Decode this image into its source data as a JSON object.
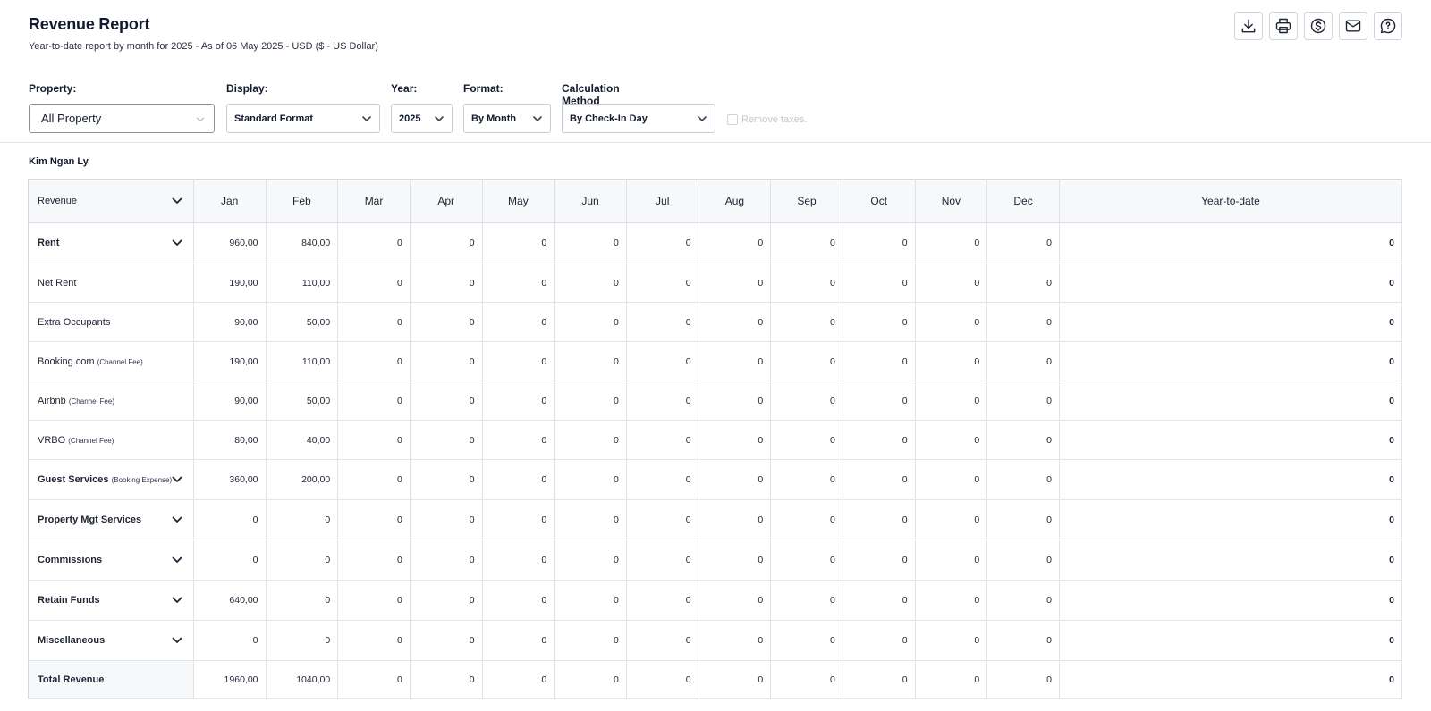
{
  "header": {
    "title": "Revenue Report",
    "subtitle": "Year-to-date report by month for 2025 - As of 06 May 2025 - USD ($ - US Dollar)"
  },
  "toolbar": {
    "icons": [
      "download-icon",
      "print-icon",
      "dollar-icon",
      "mail-icon",
      "chat-icon"
    ]
  },
  "filters": {
    "property": {
      "label": "Property:",
      "value": "All Property"
    },
    "display": {
      "label": "Display:",
      "value": "Standard Format"
    },
    "year": {
      "label": "Year:",
      "value": "2025"
    },
    "format": {
      "label": "Format:",
      "value": "By Month"
    },
    "calculation": {
      "label": "Calculation Method",
      "value": "By Check-In Day"
    },
    "remove_taxes": {
      "label": "Remove taxes.",
      "checked": false
    }
  },
  "owner": {
    "name": "Kim Ngan Ly"
  },
  "table": {
    "header_first": "Revenue",
    "months": [
      "Jan",
      "Feb",
      "Mar",
      "Apr",
      "May",
      "Jun",
      "Jul",
      "Aug",
      "Sep",
      "Oct",
      "Nov",
      "Dec"
    ],
    "ytd_label": "Year-to-date",
    "rows": [
      {
        "label": "Rent",
        "note": "",
        "bold": true,
        "expand": true,
        "values": [
          "960,00",
          "840,00",
          "0",
          "0",
          "0",
          "0",
          "0",
          "0",
          "0",
          "0",
          "0",
          "0"
        ],
        "ytd": "0"
      },
      {
        "label": "Net Rent",
        "note": "",
        "bold": false,
        "expand": false,
        "values": [
          "190,00",
          "110,00",
          "0",
          "0",
          "0",
          "0",
          "0",
          "0",
          "0",
          "0",
          "0",
          "0"
        ],
        "ytd": "0"
      },
      {
        "label": "Extra Occupants",
        "note": "",
        "bold": false,
        "expand": false,
        "values": [
          "90,00",
          "50,00",
          "0",
          "0",
          "0",
          "0",
          "0",
          "0",
          "0",
          "0",
          "0",
          "0"
        ],
        "ytd": "0"
      },
      {
        "label": "Booking.com",
        "note": "(Channel Fee)",
        "bold": false,
        "expand": false,
        "values": [
          "190,00",
          "110,00",
          "0",
          "0",
          "0",
          "0",
          "0",
          "0",
          "0",
          "0",
          "0",
          "0"
        ],
        "ytd": "0"
      },
      {
        "label": "Airbnb",
        "note": "(Channel Fee)",
        "bold": false,
        "expand": false,
        "values": [
          "90,00",
          "50,00",
          "0",
          "0",
          "0",
          "0",
          "0",
          "0",
          "0",
          "0",
          "0",
          "0"
        ],
        "ytd": "0"
      },
      {
        "label": "VRBO",
        "note": "(Channel Fee)",
        "bold": false,
        "expand": false,
        "values": [
          "80,00",
          "40,00",
          "0",
          "0",
          "0",
          "0",
          "0",
          "0",
          "0",
          "0",
          "0",
          "0"
        ],
        "ytd": "0"
      },
      {
        "label": "Guest Services",
        "note": "(Booking Expense)",
        "bold": true,
        "expand": true,
        "values": [
          "360,00",
          "200,00",
          "0",
          "0",
          "0",
          "0",
          "0",
          "0",
          "0",
          "0",
          "0",
          "0"
        ],
        "ytd": "0"
      },
      {
        "label": "Property Mgt Services",
        "note": "",
        "bold": true,
        "expand": true,
        "values": [
          "0",
          "0",
          "0",
          "0",
          "0",
          "0",
          "0",
          "0",
          "0",
          "0",
          "0",
          "0"
        ],
        "ytd": "0"
      },
      {
        "label": "Commissions",
        "note": "",
        "bold": true,
        "expand": true,
        "values": [
          "0",
          "0",
          "0",
          "0",
          "0",
          "0",
          "0",
          "0",
          "0",
          "0",
          "0",
          "0"
        ],
        "ytd": "0"
      },
      {
        "label": "Retain Funds",
        "note": "",
        "bold": true,
        "expand": true,
        "values": [
          "640,00",
          "0",
          "0",
          "0",
          "0",
          "0",
          "0",
          "0",
          "0",
          "0",
          "0",
          "0"
        ],
        "ytd": "0"
      },
      {
        "label": "Miscellaneous",
        "note": "",
        "bold": true,
        "expand": true,
        "values": [
          "0",
          "0",
          "0",
          "0",
          "0",
          "0",
          "0",
          "0",
          "0",
          "0",
          "0",
          "0"
        ],
        "ytd": "0"
      }
    ],
    "total": {
      "label": "Total Revenue",
      "values": [
        "1960,00",
        "1040,00",
        "0",
        "0",
        "0",
        "0",
        "0",
        "0",
        "0",
        "0",
        "0",
        "0"
      ],
      "ytd": "0"
    }
  }
}
